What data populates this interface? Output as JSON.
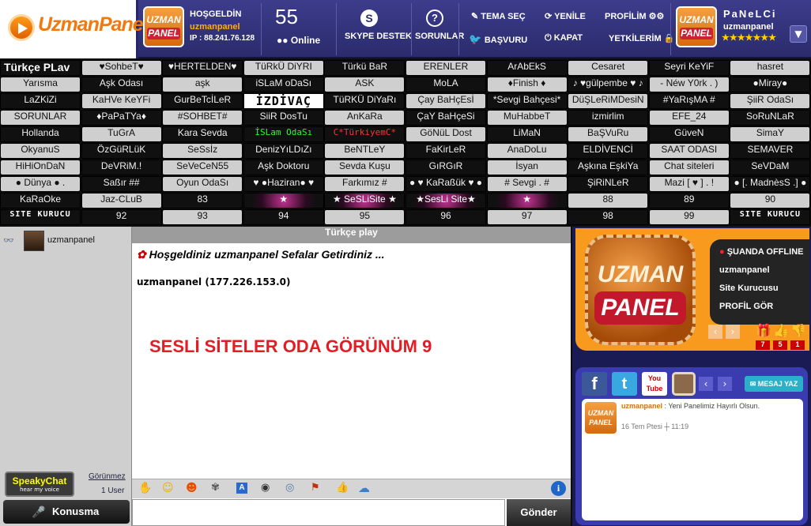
{
  "brand": {
    "logo_text": "UzmanPanel",
    "badge_top": "UZMAN",
    "badge_bottom": "PANEL"
  },
  "header": {
    "welcome_label": "HOŞGELDİN",
    "username": "uzmanpanel",
    "ip": "IP : 88.241.76.128",
    "online_count": "55",
    "online_label": "Online",
    "skype_label": "SKYPE DESTEK",
    "problems_label": "SORUNLAR",
    "theme_label": "TEMA SEÇ",
    "apply_label": "BAŞVURU",
    "refresh_label": "YENİLE",
    "close_label": "KAPAT",
    "profile_label": "PROFİLİM",
    "permissions_label": "YETKİLERİM",
    "user_title": "PaNeLCi",
    "user_name": "uzmanpanel",
    "stars": "★★★★★★★"
  },
  "rooms": {
    "rows": [
      [
        "Türkçe PLav",
        "♥SohbeT♥",
        "♥HERTELDEN♥",
        "TüRkÜ DiYRI",
        "Türkü BaR",
        "ERENLER",
        "ArAbEkS",
        "Cesaret",
        "Seyri KeYiF",
        "hasret"
      ],
      [
        "Yarısma",
        "Aşk Odası",
        "aşk",
        "iSLaM oDaSı",
        "ASK",
        "MoLA",
        "♦Finish ♦",
        "♪ ♥gülpembe ♥ ♪",
        "- Néw Y0rk . )",
        "●Miray●"
      ],
      [
        "LaZKiZi",
        "KaHVe KeYFi",
        "GurBeTcİLeR",
        "İZDİVAÇ",
        "TüRKÜ DiYaRı",
        "Çay BaHçEsİ",
        "*Sevgi Bahçesi*",
        "DüŞLeRiMDesiN",
        "#YaRışMA #",
        "ŞiiR OdaSı"
      ],
      [
        "SORUNLAR",
        "♦PaPaTYa♦",
        "#SOHBET#",
        "SiiR DosTu",
        "AnKaRa",
        "ÇaY BaHçeSi",
        "MuHabbeT",
        "izmirlim",
        "EFE_24",
        "SoRuNLaR"
      ],
      [
        "Hollanda",
        "TuGrA",
        "Kara Sevda",
        "İSLam OdaSı",
        "C*TürkiyemC*",
        "GöNüL Dost",
        "LiMaN",
        "BaŞVuRu",
        "GüveN",
        "SimaY"
      ],
      [
        "OkyanuS",
        "ÖzGüRLüK",
        "SeSsİz",
        "DenizYıLDıZı",
        "BeNTLeY",
        "FaKirLeR",
        "AnaDoLu",
        "ELDİVENCİ",
        "SAAT ODASI",
        "SEMAVER"
      ],
      [
        "HiHiOnDaN",
        "DeVRiM.!",
        "SeVeCeN55",
        "Aşk Doktoru",
        "Sevda Kuşu",
        "GıRGıR",
        "İsyan",
        "Aşkına EşkiYa",
        "Chat siteleri",
        "SeVDaM"
      ],
      [
        "● Dünya ● .",
        "Saßır ##",
        "Oyun OdaSı",
        "♥ ●Haziran● ♥",
        "Farkımız #",
        "● ♥ KaRaßük ♥ ●",
        "# Sevgi . #",
        "ŞiRiNLeR",
        "Mazi [ ♥ ] . !",
        "● [. MadnèsS .] ●"
      ],
      [
        "KaRaOke",
        "Jaz-CLuB",
        "83",
        "★",
        "★ SeSLiSite ★",
        "★SesLi Site★",
        "★",
        "88",
        "89",
        "90"
      ],
      [
        "SİTE KURUCU",
        "92",
        "93",
        "94",
        "95",
        "96",
        "97",
        "98",
        "99",
        "SİTE KURUCU"
      ]
    ]
  },
  "left_panel": {
    "user": "uzmanpanel",
    "speaky_label": "SpeakyChat",
    "speaky_sub": "hear my voice",
    "visibility": "Görünmez",
    "user_count": "1 User",
    "talk_label": "Konusma"
  },
  "chat": {
    "title": "Türkçe play",
    "welcome": "Hoşgeldiniz uzmanpanel Sefalar Getirdiniz ...",
    "user_ip": "uzmanpanel (177.226.153.0)",
    "headline": "SESLİ SİTELER ODA GÖRÜNÜM 9",
    "send_label": "Gönder",
    "input_value": ""
  },
  "right_panel": {
    "status": "ŞUANDA OFFLINE",
    "menu": [
      "uzmanpanel",
      "Site Kurucusu",
      "PROFİL GÖR"
    ],
    "counts": [
      "7",
      "5",
      "1"
    ],
    "message_button": "MESAJ YAZ",
    "post_user": "uzmanpanel",
    "post_text": ": Yeni Panelimiz Hayırlı Olsun.",
    "post_time": "16 Tem Ptesi ┼ 11:19"
  }
}
